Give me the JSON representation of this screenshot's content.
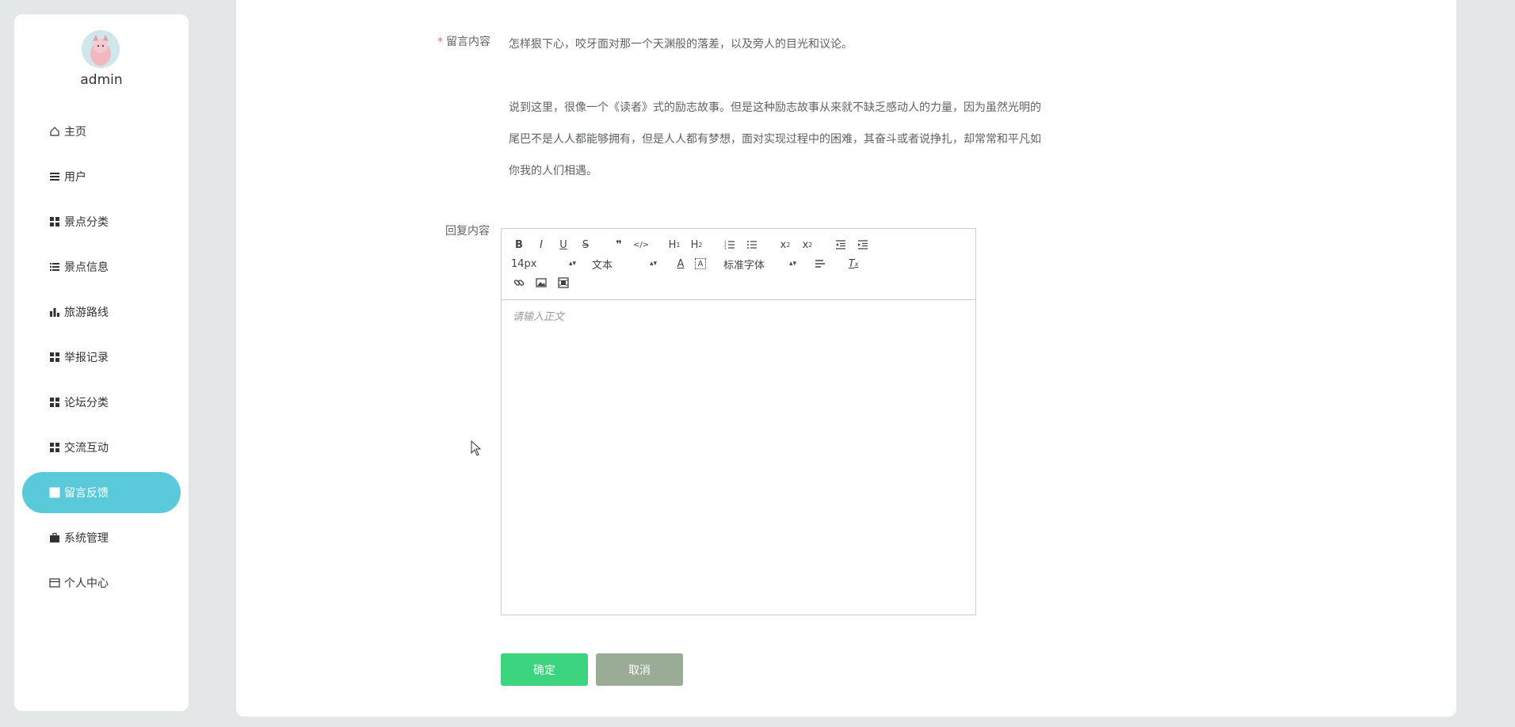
{
  "user": {
    "name": "admin"
  },
  "menu": [
    {
      "label": "主页",
      "icon": "home-icon"
    },
    {
      "label": "用户",
      "icon": "list-icon"
    },
    {
      "label": "景点分类",
      "icon": "grid-icon"
    },
    {
      "label": "景点信息",
      "icon": "list-icon"
    },
    {
      "label": "旅游路线",
      "icon": "bar-chart-icon"
    },
    {
      "label": "举报记录",
      "icon": "grid-icon"
    },
    {
      "label": "论坛分类",
      "icon": "grid-icon"
    },
    {
      "label": "交流互动",
      "icon": "grid-icon"
    },
    {
      "label": "留言反馈",
      "icon": "table-icon",
      "active": true
    },
    {
      "label": "系统管理",
      "icon": "briefcase-icon"
    },
    {
      "label": "个人中心",
      "icon": "card-icon"
    }
  ],
  "form": {
    "message_label": "留言内容",
    "message_lines": [
      "怎样狠下心，咬牙面对那一个天渊般的落差，以及旁人的目光和议论。",
      "说到这里，很像一个《读者》式的励志故事。但是这种励志故事从来就不缺乏感动人的力量，因为虽然光明的",
      "尾巴不是人人都能够拥有，但是人人都有梦想，面对实现过程中的困难，其奋斗或者说挣扎，却常常和平凡如",
      "你我的人们相遇。"
    ],
    "reply_label": "回复内容",
    "editor": {
      "font_size": "14px",
      "paragraph": "文本",
      "font_family": "标准字体",
      "placeholder": "请输入正文"
    },
    "confirm_label": "确定",
    "cancel_label": "取消"
  },
  "colors": {
    "accent": "#5ac9da",
    "confirm": "#3dd47f",
    "cancel": "#9aac95",
    "required": "#f56c6c"
  }
}
